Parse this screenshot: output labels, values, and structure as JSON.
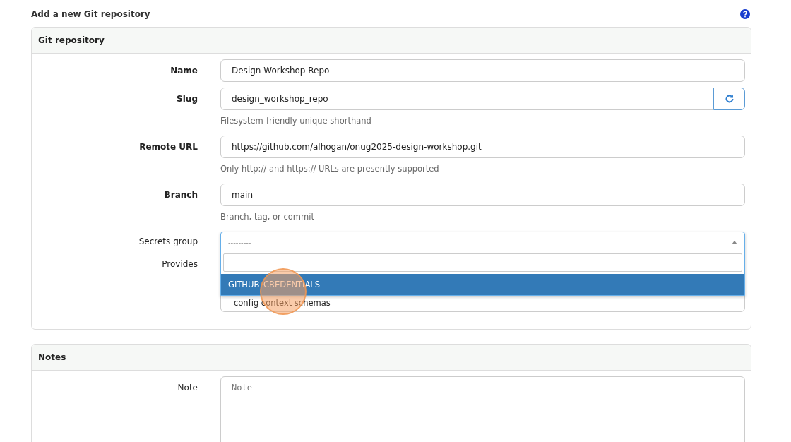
{
  "page_title": "Add a new Git repository",
  "git_repository": {
    "title": "Git repository",
    "fields": [
      {
        "kind": "text",
        "label": "Name",
        "value": "Design Workshop Repo"
      },
      {
        "kind": "slug",
        "label": "Slug",
        "value": "design_workshop_repo",
        "help": "Filesystem-friendly unique shorthand"
      },
      {
        "kind": "text",
        "label": "Remote URL",
        "value": "https://github.com/alhogan/onug2025-design-workshop.git",
        "help": "Only http:// and https:// URLs are presently supported"
      },
      {
        "kind": "text",
        "label": "Branch",
        "value": "main",
        "help": "Branch, tag, or commit"
      }
    ],
    "secrets_group": {
      "label": "Secrets group",
      "placeholder": "---------",
      "expanded": true,
      "options": [
        {
          "label": "GITHUB_CREDENTIALS",
          "selected": true
        }
      ]
    },
    "provides": {
      "label": "Provides",
      "items": [
        "config context schemas"
      ]
    }
  },
  "notes": {
    "title": "Notes",
    "label": "Note",
    "placeholder": "Note"
  },
  "click_marker": true
}
